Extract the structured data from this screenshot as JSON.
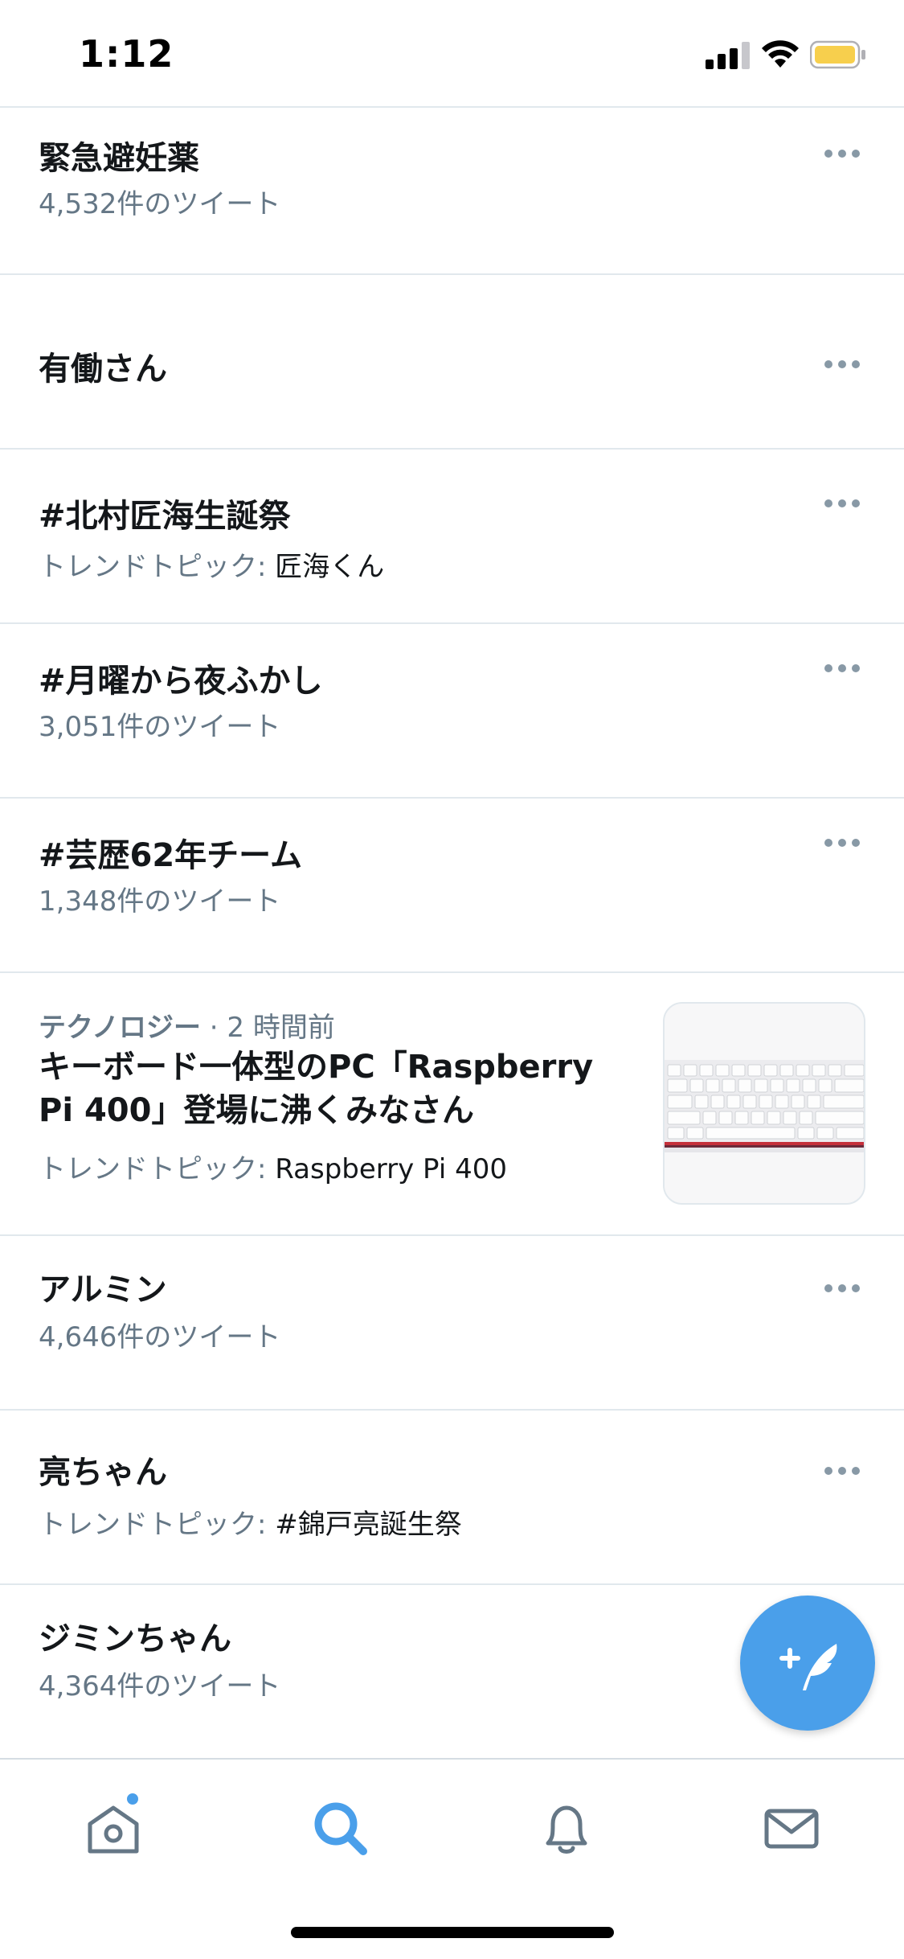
{
  "status_bar": {
    "time": "1:12"
  },
  "trends": [
    {
      "title": "緊急避妊薬",
      "subtitle": "4,532件のツイート"
    },
    {
      "title": "有働さん"
    },
    {
      "title": "#北村匠海生誕祭",
      "subtitle_prefix": "トレンドトピック: ",
      "subtitle_topic": "匠海くん"
    },
    {
      "title": "#月曜から夜ふかし",
      "subtitle": "3,051件のツイート"
    },
    {
      "title": "#芸歴62年チーム",
      "subtitle": "1,348件のツイート"
    },
    {
      "title": "アルミン",
      "subtitle": "4,646件のツイート"
    },
    {
      "title": "亮ちゃん",
      "subtitle_prefix": "トレンドトピック: ",
      "subtitle_topic": "#錦戸亮誕生祭"
    },
    {
      "title": "ジミンちゃん",
      "subtitle": "4,364件のツイート"
    }
  ],
  "news": {
    "category": "テクノロジー",
    "time": " · 2 時間前",
    "title_line1": "キーボード一体型のPC「Raspberry",
    "title_line2": "Pi 400」登場に沸くみなさん",
    "subtitle_prefix": "トレンドトピック: ",
    "subtitle_topic": "Raspberry Pi 400"
  },
  "tab_bar": {
    "tabs": [
      {
        "icon": "home-icon",
        "active": false,
        "has_badge": true
      },
      {
        "icon": "search-icon",
        "active": true
      },
      {
        "icon": "bell-icon",
        "active": false
      },
      {
        "icon": "mail-icon",
        "active": false
      }
    ]
  },
  "colors": {
    "accent": "#4a9fea",
    "text_primary": "#14171a",
    "text_secondary": "#657786",
    "divider": "#e1e8ed",
    "icon_gray": "#657786",
    "battery": "#f7cf4d"
  },
  "fab_icon": "compose-tweet-icon"
}
